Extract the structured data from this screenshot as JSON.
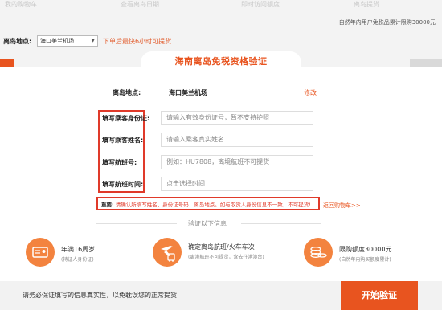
{
  "background": {
    "nav": [
      "我的购物车",
      "查看离岛日期",
      "即时访问额度",
      "离岛提货"
    ],
    "note": "自然年内用户免税品累计限购30000元",
    "location_label": "离岛地点:",
    "location_value": "海口美兰机场",
    "location_tip": "下单后最快6小时可提货"
  },
  "modal": {
    "title": "海南离岛免税资格验证",
    "location_label": "离岛地点:",
    "location_value": "海口美兰机场",
    "edit_label": "修改",
    "fields": [
      {
        "label": "填写乘客身份证:",
        "placeholder": "请输入有效身份证号，暂不支持护照"
      },
      {
        "label": "填写乘客姓名:",
        "placeholder": "请输入乘客真实姓名"
      },
      {
        "label": "填写航班号:",
        "placeholder": "例如：HU7808，离境航班不可提货"
      },
      {
        "label": "填写航班时间:",
        "placeholder": "点击选择时间"
      }
    ],
    "notice_prefix": "重要:",
    "notice_text": "请确认所填写姓名、身份证号码、离岛地点。如与取货人身份信息不一致，不可提货!",
    "back_link": "返回购物车>>",
    "divider": "验证以下信息",
    "features": [
      {
        "title": "年满16周岁",
        "sub": "(持证人身份证)"
      },
      {
        "title": "确定离岛航班/火车车次",
        "sub": "(离港航班不可提货，含去往港澳台)"
      },
      {
        "title": "限购额度30000元",
        "sub": "(自然年内购买额度累计)"
      }
    ]
  },
  "footer": {
    "text": "请务必保证填写的信息真实性，以免耽误您的正常提货",
    "start_button": "开始验证"
  },
  "colors": {
    "accent": "#e8541f",
    "highlight_box": "#e03a2a",
    "feature_icon": "#f3833f"
  }
}
